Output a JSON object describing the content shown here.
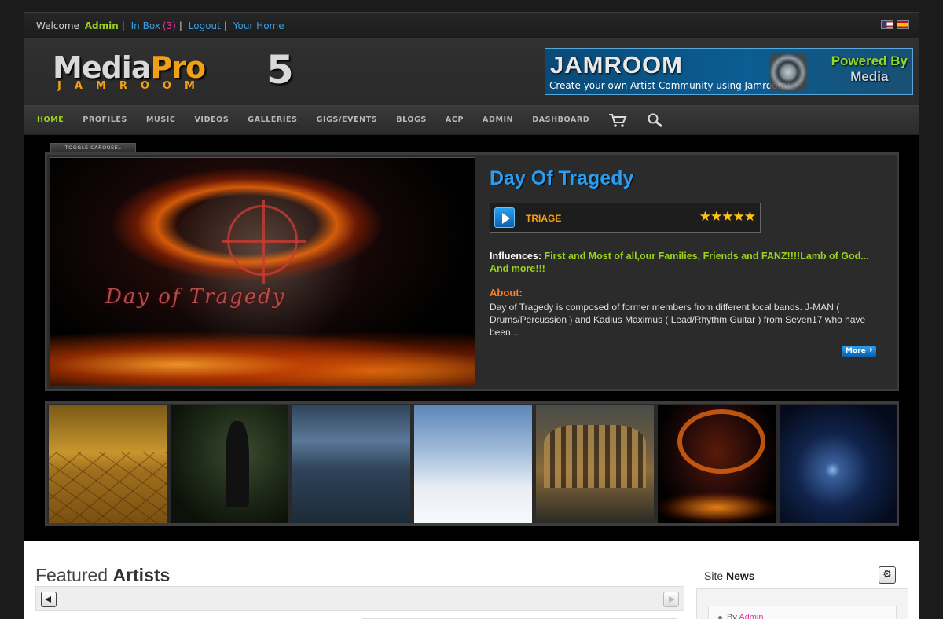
{
  "topbar": {
    "welcome": "Welcome",
    "user": "Admin",
    "sep": "|",
    "inbox": "In Box",
    "inbox_count": "(3)",
    "logout": "Logout",
    "home": "Your Home"
  },
  "header": {
    "logo_media": "Media",
    "logo_pro": "Pro",
    "logo_five": "5",
    "logo_sub": "JAMROOM",
    "banner_brand": "JAMROOM",
    "banner_tagline": "Create your own Artist Community using Jamroom!",
    "banner_powered": "Powered By",
    "banner_media": "Media"
  },
  "nav": {
    "items": [
      "HOME",
      "PROFILES",
      "MUSIC",
      "VIDEOS",
      "GALLERIES",
      "GIGS/EVENTS",
      "BLOGS",
      "ACP",
      "ADMIN",
      "DASHBOARD"
    ],
    "cart_icon": "cart-icon",
    "search_icon": "search-icon"
  },
  "carousel": {
    "toggle": "TOGGLE CAROUSEL",
    "image_text": "Day of Tragedy",
    "title": "Day Of Tragedy",
    "track": "TRIAGE",
    "rating": "★★★★★",
    "influences_label": "Influences:",
    "influences": "First and Most of all,our Families, Friends and FANZ!!!!Lamb of God... And more!!!",
    "about_label": "About:",
    "about": "Day of Tragedy is composed of former members from different local bands. J-MAN ( Drums/Percussion ) and Kadius Maximus ( Lead/Rhythm Guitar ) from Seven17 who have been...",
    "more": "More"
  },
  "featured": {
    "title_light": "Featured",
    "title_bold": "Artists"
  },
  "news": {
    "title_light": "Site",
    "title_bold": "News",
    "gear": "⚙",
    "by": "By",
    "author": "Admin"
  },
  "colors": {
    "accent_green": "#9bd21e",
    "link_blue": "#3a9ee4",
    "title_blue": "#2a9df0",
    "orange": "#f0a015",
    "pink": "#e0369a"
  }
}
